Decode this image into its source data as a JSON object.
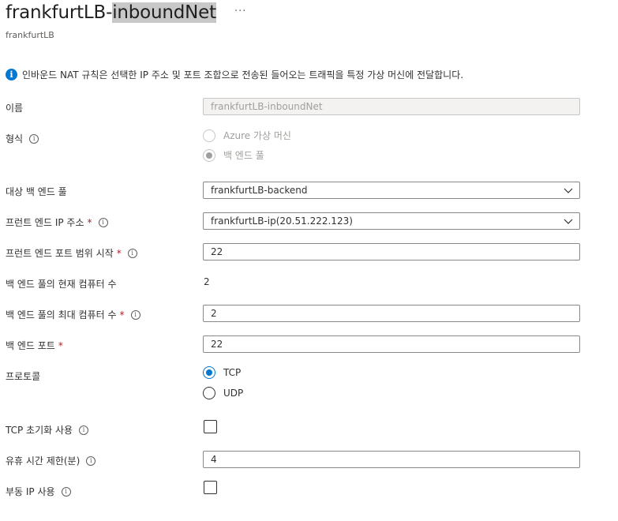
{
  "header": {
    "title_part1": "frankfurtLB-",
    "title_part2": "inboundNet",
    "more": "···",
    "subtitle": "frankfurtLB"
  },
  "info": {
    "icon": "info-icon",
    "text": "인바운드 NAT 규칙은 선택한 IP 주소 및 포트 조합으로 전송된 들어오는 트래픽을 특정 가상 머신에 전달합니다."
  },
  "form": {
    "name_label": "이름",
    "name_value": "frankfurtLB-inboundNet",
    "type_label": "형식",
    "type_options": [
      "Azure 가상 머신",
      "백 엔드 풀"
    ],
    "type_selected": "백 엔드 풀",
    "target_pool_label": "대상 백 엔드 풀",
    "target_pool_value": "frankfurtLB-backend",
    "frontend_ip_label": "프런트 엔드 IP 주소",
    "frontend_ip_value": "frankfurtLB-ip(20.51.222.123)",
    "frontend_port_label": "프런트 엔드 포트 범위 시작",
    "frontend_port_value": "22",
    "current_count_label": "백 엔드 풀의 현재 컴퓨터 수",
    "current_count_value": "2",
    "max_count_label": "백 엔드 풀의 최대 컴퓨터 수",
    "max_count_value": "2",
    "backend_port_label": "백 엔드 포트",
    "backend_port_value": "22",
    "protocol_label": "프로토콜",
    "protocol_options": [
      "TCP",
      "UDP"
    ],
    "protocol_selected": "TCP",
    "tcp_reset_label": "TCP 초기화 사용",
    "tcp_reset_checked": false,
    "idle_timeout_label": "유휴 시간 제한(분)",
    "idle_timeout_value": "4",
    "floating_ip_label": "부동 IP 사용",
    "floating_ip_checked": false,
    "required_mark": "*",
    "tooltip_glyph": "i"
  }
}
